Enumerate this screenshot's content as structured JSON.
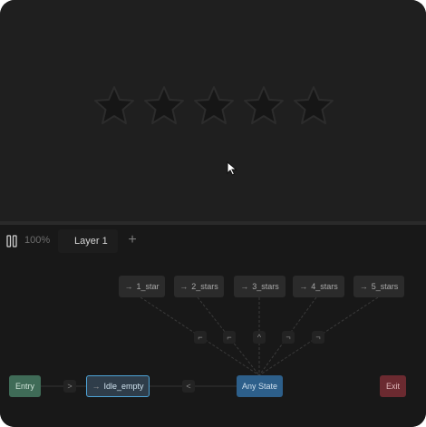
{
  "toolbar": {
    "zoom": "100%",
    "layer_tab": "Layer 1",
    "add_layer_symbol": "+"
  },
  "stars": {
    "count": 5,
    "filled": 0
  },
  "state_machine": {
    "states_top": [
      {
        "label": "1_star"
      },
      {
        "label": "2_stars"
      },
      {
        "label": "3_stars"
      },
      {
        "label": "4_stars"
      },
      {
        "label": "5_stars"
      }
    ],
    "entry": "Entry",
    "idle": "Idle_empty",
    "any_state": "Any State",
    "exit": "Exit",
    "arrow_glyph": "→"
  },
  "colors": {
    "entry": "#3f6b57",
    "idle_border": "#4da3d6",
    "any_state": "#2d5f8a",
    "exit": "#6b2a30"
  }
}
